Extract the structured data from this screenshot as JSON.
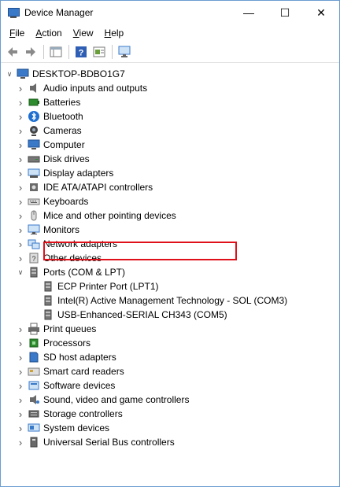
{
  "window": {
    "title": "Device Manager",
    "minimize": "—",
    "maximize": "☐",
    "close": "✕"
  },
  "menu": [
    {
      "label": "File",
      "key": "F",
      "rest": "ile"
    },
    {
      "label": "Action",
      "key": "A",
      "rest": "ction"
    },
    {
      "label": "View",
      "key": "V",
      "rest": "iew"
    },
    {
      "label": "Help",
      "key": "H",
      "rest": "elp"
    }
  ],
  "tree": {
    "root": "DESKTOP-BDBO1G7",
    "categories": [
      {
        "label": "Audio inputs and outputs",
        "icon": "speaker-icon",
        "color": "#6a6a6a"
      },
      {
        "label": "Batteries",
        "icon": "battery-icon",
        "color": "#2e8b2e"
      },
      {
        "label": "Bluetooth",
        "icon": "bluetooth-icon",
        "color": "#1f6fd1"
      },
      {
        "label": "Cameras",
        "icon": "camera-icon",
        "color": "#444444"
      },
      {
        "label": "Computer",
        "icon": "computer-icon",
        "color": "#3a79c8"
      },
      {
        "label": "Disk drives",
        "icon": "disk-drive-icon",
        "color": "#777777"
      },
      {
        "label": "Display adapters",
        "icon": "display-adapter-icon",
        "color": "#3a79c8"
      },
      {
        "label": "IDE ATA/ATAPI controllers",
        "icon": "ide-controller-icon",
        "color": "#6a6a6a"
      },
      {
        "label": "Keyboards",
        "icon": "keyboard-icon",
        "color": "#777777"
      },
      {
        "label": "Mice and other pointing devices",
        "icon": "mouse-icon",
        "color": "#777777"
      },
      {
        "label": "Monitors",
        "icon": "monitor-icon",
        "color": "#3a79c8"
      },
      {
        "label": "Network adapters",
        "icon": "network-adapter-icon",
        "color": "#3a79c8"
      },
      {
        "label": "Other devices",
        "icon": "other-devices-icon",
        "color": "#777777"
      },
      {
        "label": "Ports (COM & LPT)",
        "icon": "port-icon",
        "color": "#6a6a6a",
        "expanded": true,
        "children": [
          {
            "label": "ECP Printer Port (LPT1)",
            "icon": "port-icon"
          },
          {
            "label": "Intel(R) Active Management Technology - SOL (COM3)",
            "icon": "port-icon"
          },
          {
            "label": "USB-Enhanced-SERIAL CH343 (COM5)",
            "icon": "port-icon",
            "highlighted": true
          }
        ]
      },
      {
        "label": "Print queues",
        "icon": "printer-icon",
        "color": "#6a6a6a"
      },
      {
        "label": "Processors",
        "icon": "processor-icon",
        "color": "#2e8b2e"
      },
      {
        "label": "SD host adapters",
        "icon": "sd-adapter-icon",
        "color": "#3a79c8"
      },
      {
        "label": "Smart card readers",
        "icon": "smart-card-icon",
        "color": "#777777"
      },
      {
        "label": "Software devices",
        "icon": "software-device-icon",
        "color": "#3a79c8"
      },
      {
        "label": "Sound, video and game controllers",
        "icon": "sound-icon",
        "color": "#6a6a6a"
      },
      {
        "label": "Storage controllers",
        "icon": "storage-controller-icon",
        "color": "#6a6a6a"
      },
      {
        "label": "System devices",
        "icon": "system-device-icon",
        "color": "#3a79c8"
      },
      {
        "label": "Universal Serial Bus controllers",
        "icon": "usb-icon",
        "color": "#6a6a6a"
      }
    ]
  },
  "colors": {
    "highlight": "#e0101a",
    "accent": "#3a79c8"
  }
}
